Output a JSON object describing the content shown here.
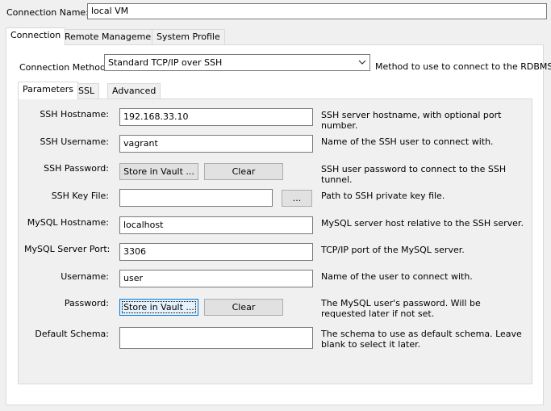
{
  "connection_name": {
    "label": "Connection Name:",
    "value": "local VM"
  },
  "main_tabs": [
    {
      "label": "Connection",
      "active": true
    },
    {
      "label": "Remote Management",
      "active": false
    },
    {
      "label": "System Profile",
      "active": false
    }
  ],
  "connection_method": {
    "label": "Connection Method:",
    "value": "Standard TCP/IP over SSH",
    "help": "Method to use to connect to the RDBMS"
  },
  "sub_tabs": [
    {
      "label": "Parameters",
      "active": true
    },
    {
      "label": "SSL",
      "active": false
    },
    {
      "label": "Advanced",
      "active": false
    }
  ],
  "fields": {
    "ssh_hostname": {
      "label": "SSH Hostname:",
      "value": "192.168.33.10",
      "help": "SSH server hostname, with  optional port number."
    },
    "ssh_username": {
      "label": "SSH Username:",
      "value": "vagrant",
      "help": "Name of the SSH user to connect with."
    },
    "ssh_password": {
      "label": "SSH Password:",
      "store_label": "Store in Vault ...",
      "clear_label": "Clear",
      "help": "SSH user password to connect to the SSH tunnel."
    },
    "ssh_key_file": {
      "label": "SSH Key File:",
      "value": "",
      "browse_label": "...",
      "help": "Path to SSH private key file."
    },
    "mysql_hostname": {
      "label": "MySQL Hostname:",
      "value": "localhost",
      "help": "MySQL server host relative to the SSH server."
    },
    "mysql_port": {
      "label": "MySQL Server Port:",
      "value": "3306",
      "help": "TCP/IP port of the MySQL server."
    },
    "username": {
      "label": "Username:",
      "value": "user",
      "help": "Name of the user to connect with."
    },
    "password": {
      "label": "Password:",
      "store_label": "Store in Vault ...",
      "clear_label": "Clear",
      "help": "The MySQL user's password. Will be requested later if not set."
    },
    "default_schema": {
      "label": "Default Schema:",
      "value": "",
      "help": "The schema to use as default schema. Leave blank to select it later."
    }
  },
  "colors": {
    "window_bg": "#f0f0f0",
    "panel_bg": "#ffffff",
    "focus_border": "#0078d7"
  }
}
